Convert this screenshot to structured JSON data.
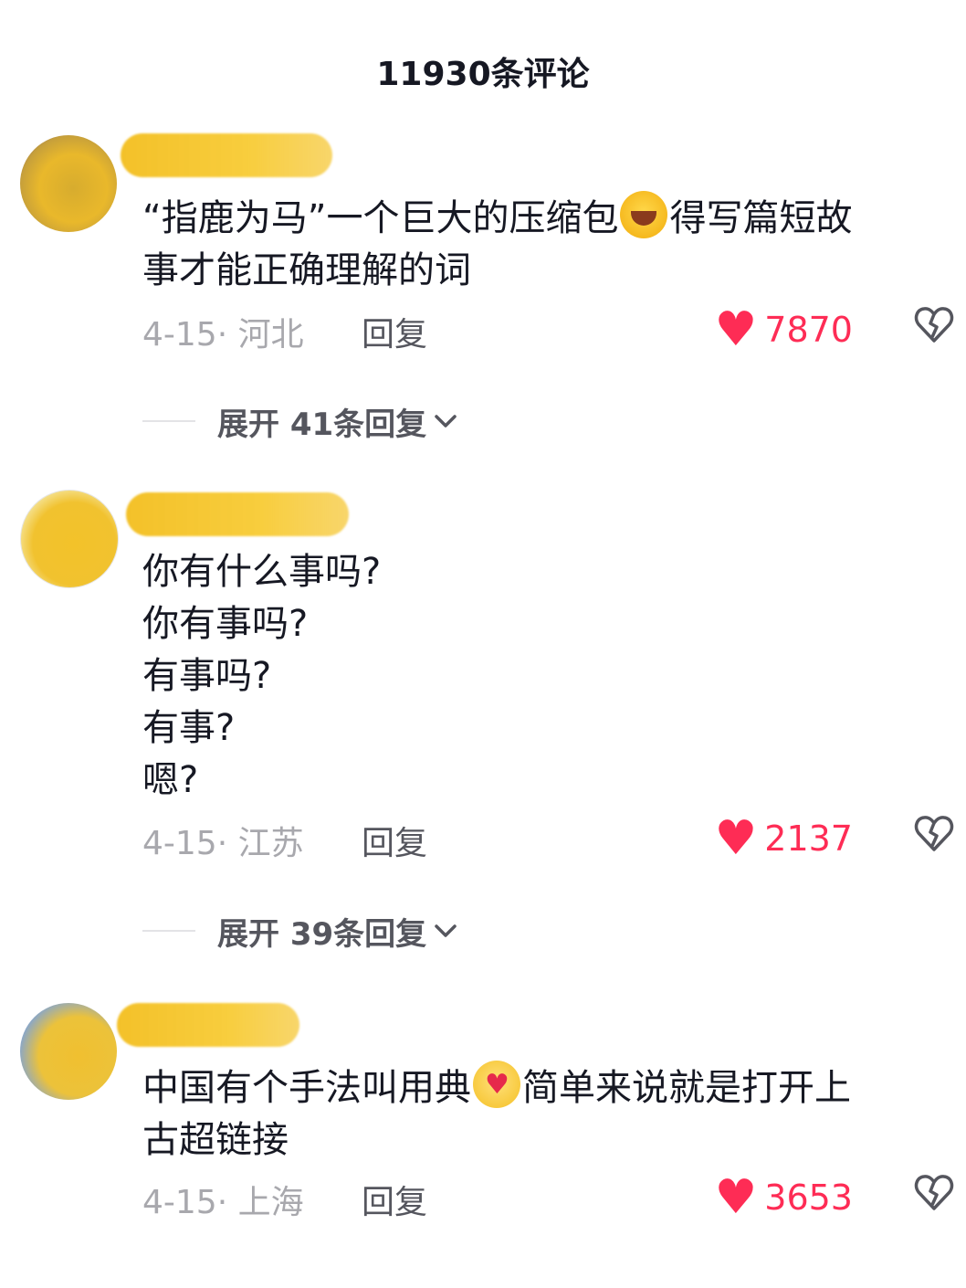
{
  "header": {
    "title": "11930条评论"
  },
  "comments": [
    {
      "text_lines": [
        "“指鹿为马”一个巨大的压缩包",
        "得写篇短故",
        "事才能正确理解的词"
      ],
      "emoji": "laughing-crying-emoji",
      "date_location": "4-15· 河北",
      "reply_label": "回复",
      "likes": "7870",
      "expand_label": "展开 41条回复"
    },
    {
      "text_lines": [
        "你有什么事吗?",
        "你有事吗?",
        "有事吗?",
        "有事?",
        "嗯?"
      ],
      "date_location": "4-15· 江苏",
      "reply_label": "回复",
      "likes": "2137",
      "expand_label": "展开 39条回复"
    },
    {
      "text_lines": [
        "中国有个手法叫用典",
        "简单来说就是打开上",
        "古超链接"
      ],
      "emoji": "hugging-heart-emoji",
      "date_location": "4-15· 上海",
      "reply_label": "回复",
      "likes": "3653"
    }
  ],
  "colors": {
    "like": "#fe2c55",
    "redaction": "#f3be1e",
    "meta_text": "#a8a8ad"
  }
}
